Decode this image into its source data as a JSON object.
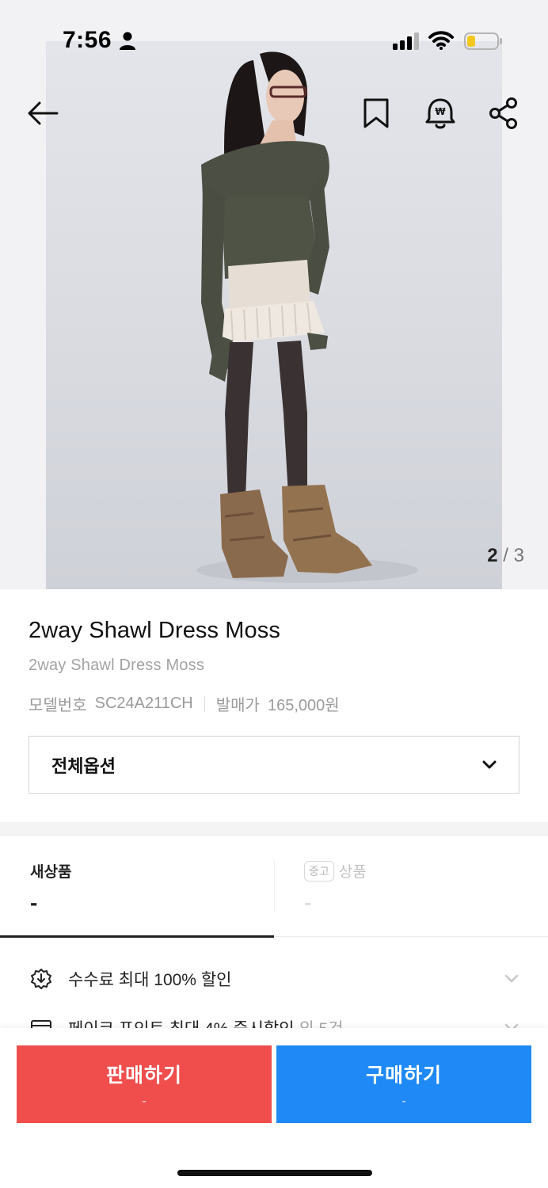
{
  "status_bar": {
    "time": "7:56"
  },
  "nav": {
    "back_icon": "arrow-left-icon",
    "bookmark_icon": "bookmark-icon",
    "alarm_icon": "price-alarm-bell-icon",
    "share_icon": "share-icon"
  },
  "gallery": {
    "current": "2",
    "separator": "/",
    "total": "3"
  },
  "product": {
    "title": "2way Shawl Dress Moss",
    "subtitle": "2way Shawl Dress Moss",
    "model_label": "모델번호",
    "model_value": "SC24A211CH",
    "release_label": "발매가",
    "release_value": "165,000원"
  },
  "option": {
    "label": "전체옵션"
  },
  "tabs": {
    "new_label": "새상품",
    "new_price": "-",
    "used_badge": "중고",
    "used_label": "상품",
    "used_price": "-"
  },
  "benefits": [
    {
      "text": "수수료 최대 100% 할인",
      "sub": ""
    },
    {
      "text": "페이코 포인트 최대 4% 즉시할인",
      "sub": " 외 5건"
    }
  ],
  "actions": {
    "sell_label": "판매하기",
    "sell_price": "-",
    "buy_label": "구매하기",
    "buy_price": "-"
  },
  "colors": {
    "sell": "#f04d4d",
    "buy": "#1f89f5"
  }
}
